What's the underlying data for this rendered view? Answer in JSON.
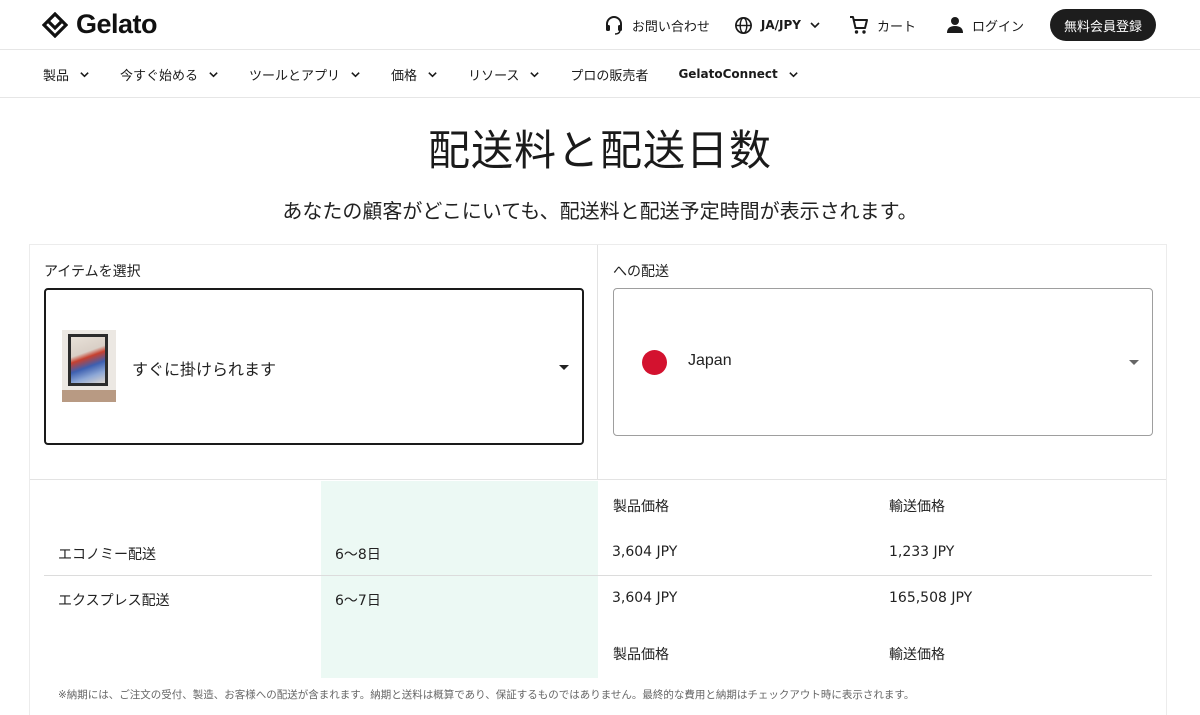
{
  "header": {
    "logo_text": "Gelato",
    "contact_label": "お問い合わせ",
    "lang_label": "JA/JPY",
    "cart_label": "カート",
    "login_label": "ログイン",
    "signup_label": "無料会員登録"
  },
  "nav": {
    "items": [
      {
        "label": "製品",
        "dropdown": true
      },
      {
        "label": "今すぐ始める",
        "dropdown": true
      },
      {
        "label": "ツールとアプリ",
        "dropdown": true
      },
      {
        "label": "価格",
        "dropdown": true
      },
      {
        "label": "リソース",
        "dropdown": true
      },
      {
        "label": "プロの販売者",
        "dropdown": false
      },
      {
        "label": "GelatoConnect",
        "dropdown": true
      }
    ]
  },
  "page": {
    "title": "配送料と配送日数",
    "subtitle": "あなたの顧客がどこにいても、配送料と配送予定時間が表示されます。"
  },
  "selector": {
    "item_label": "アイテムを選択",
    "item_value": "すぐに掛けられます",
    "dest_label": "への配送",
    "dest_value": "Japan"
  },
  "shipping": {
    "headers": {
      "product_price": "製品価格",
      "shipping_price": "輸送価格"
    },
    "rows": [
      {
        "method": "エコノミー配送",
        "days": "6〜8日",
        "product_price": "3,604 JPY",
        "shipping_price": "1,233 JPY"
      },
      {
        "method": "エクスプレス配送",
        "days": "6〜7日",
        "product_price": "3,604 JPY",
        "shipping_price": "165,508 JPY"
      }
    ],
    "footnote": "※納期には、ご注文の受付、製造、お客様への配送が含まれます。納期と送料は概算であり、保証するものではありません。最終的な費用と納期はチェックアウト時に表示されます。"
  },
  "colors": {
    "highlight": "#ecf9f4",
    "button_bg": "#1d1d1d",
    "flag_red": "#d3122f"
  }
}
